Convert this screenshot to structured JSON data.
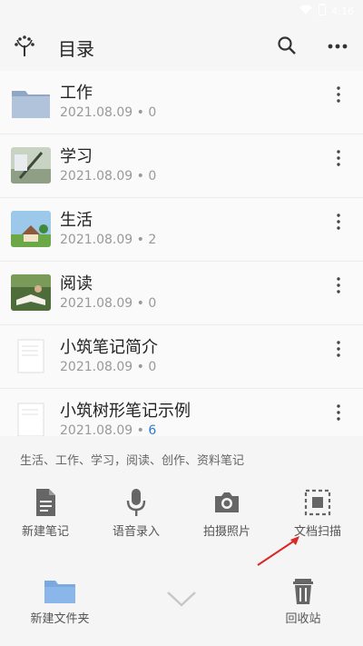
{
  "status": {
    "time": "4:16"
  },
  "header": {
    "title": "目录"
  },
  "items": [
    {
      "name": "工作",
      "date": "2021.08.09",
      "count": "0"
    },
    {
      "name": "学习",
      "date": "2021.08.09",
      "count": "0"
    },
    {
      "name": "生活",
      "date": "2021.08.09",
      "count": "2"
    },
    {
      "name": "阅读",
      "date": "2021.08.09",
      "count": "0"
    },
    {
      "name": "小筑笔记简介",
      "date": "2021.08.09",
      "count": "0"
    },
    {
      "name": "小筑树形笔记示例",
      "date": "2021.08.09",
      "count": "6"
    }
  ],
  "sheet": {
    "tags": "生活、工作、学习，阅读、创作、资料笔记",
    "actions": [
      {
        "label": "新建笔记",
        "icon": "document-icon"
      },
      {
        "label": "语音录入",
        "icon": "microphone-icon"
      },
      {
        "label": "拍摄照片",
        "icon": "camera-icon"
      },
      {
        "label": "文档扫描",
        "icon": "scan-icon"
      }
    ],
    "new_folder": "新建文件夹",
    "recycle_bin": "回收站"
  },
  "colors": {
    "accent_blue": "#2b7bd6",
    "folder_blue": "#7aa9e0",
    "arrow_red": "#d9292a"
  }
}
